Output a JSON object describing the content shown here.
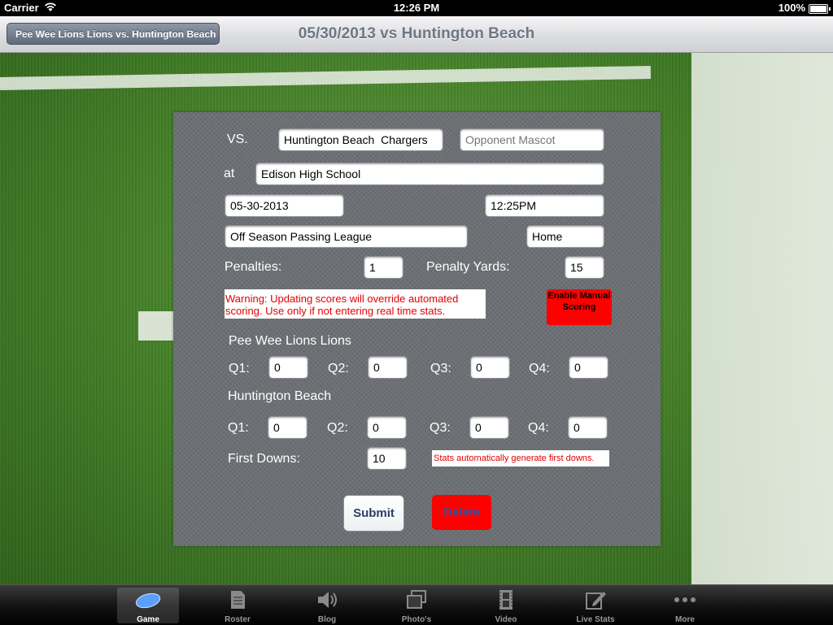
{
  "status_bar": {
    "carrier": "Carrier",
    "time": "12:26 PM",
    "battery": "100%"
  },
  "nav": {
    "back_label": "Pee Wee Lions Lions vs. Huntington Beach",
    "title": "05/30/2013 vs Huntington Beach"
  },
  "form": {
    "vs_label": "VS.",
    "opponent_name": "Huntington Beach  Chargers",
    "opponent_mascot_placeholder": "Opponent Mascot",
    "at_label": "at",
    "location": "Edison High School",
    "date": "05-30-2013",
    "time": "12:25PM",
    "league": "Off Season Passing League",
    "home_away": "Home",
    "penalties_label": "Penalties:",
    "penalties": "1",
    "penalty_yards_label": "Penalty Yards:",
    "penalty_yards": "15",
    "warning": "Warning: Updating scores will override automated scoring. Use only if not entering real time stats.",
    "enable_manual_scoring": "Enable Manual Scoring",
    "home_team": {
      "name": "Pee Wee Lions Lions",
      "q1_label": "Q1:",
      "q1": "0",
      "q2_label": "Q2:",
      "q2": "0",
      "q3_label": "Q3:",
      "q3": "0",
      "q4_label": "Q4:",
      "q4": "0"
    },
    "away_team": {
      "name": "Huntington Beach",
      "q1_label": "Q1:",
      "q1": "0",
      "q2_label": "Q2:",
      "q2": "0",
      "q3_label": "Q3:",
      "q3": "0",
      "q4_label": "Q4:",
      "q4": "0"
    },
    "first_downs_label": "First Downs:",
    "first_downs": "10",
    "stats_note": "Stats automatically generate first downs.",
    "submit_label": "Submit",
    "delete_label": "Delete"
  },
  "tabs": [
    {
      "label": "Game",
      "icon": "football-icon",
      "active": true
    },
    {
      "label": "Roster",
      "icon": "document-icon",
      "active": false
    },
    {
      "label": "Blog",
      "icon": "speaker-icon",
      "active": false
    },
    {
      "label": "Photo's",
      "icon": "photos-icon",
      "active": false
    },
    {
      "label": "Video",
      "icon": "film-icon",
      "active": false
    },
    {
      "label": "Live Stats",
      "icon": "edit-icon",
      "active": false
    },
    {
      "label": "More",
      "icon": "more-icon",
      "active": false
    }
  ],
  "colors": {
    "warning_red": "#e00000",
    "button_red": "#ff0000",
    "panel_gray": "#6b6e73",
    "nav_title": "#6e7784"
  }
}
